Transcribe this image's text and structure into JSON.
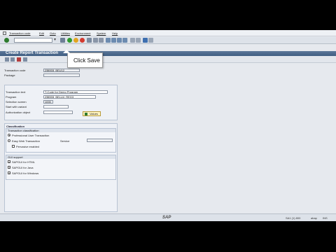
{
  "menubar": {
    "items": [
      "Transaction code",
      "Edit",
      "Goto",
      "Utilities",
      "Environment",
      "System",
      "Help"
    ]
  },
  "toolbar": {
    "command_value": ""
  },
  "title": "Create Report Transaction",
  "tooltip": "Click Save",
  "header_fields": {
    "transaction_code_label": "Transaction code",
    "transaction_code_value": "ZBBSB_BEU12",
    "package_label": "Package"
  },
  "start_object": {
    "transaction_text_label": "Transaction text",
    "transaction_text_value": "T-Code for Demo Program",
    "program_label": "Program",
    "program_value": "ZBBSB_BELU4_REG3",
    "selection_screen_label": "Selection screen",
    "selection_screen_value": "1000",
    "start_with_variant_label": "Start with variant",
    "authorization_object_label": "Authorization object",
    "values_button": "Values"
  },
  "classification": {
    "title": "Classification",
    "transaction_classification": {
      "title": "Transaction classification",
      "professional_user": "Professional User Transaction",
      "easy_web": "Easy Web Transaction",
      "service_label": "Service",
      "pervasive": "Pervasive enabled"
    },
    "gui_support": {
      "title": "GUI support",
      "html": "SAPGUI for HTML",
      "java": "SAPGUI for Java",
      "windows": "SAPGUI for Windows"
    }
  },
  "statusbar": {
    "logo": "SAP",
    "system": "SA1 (1) 800",
    "host": "abap",
    "mode": "INS"
  },
  "colors": {
    "title_bar": "#4a6890",
    "frame": "#e6e9ee",
    "values_button": "#fff4c2"
  }
}
